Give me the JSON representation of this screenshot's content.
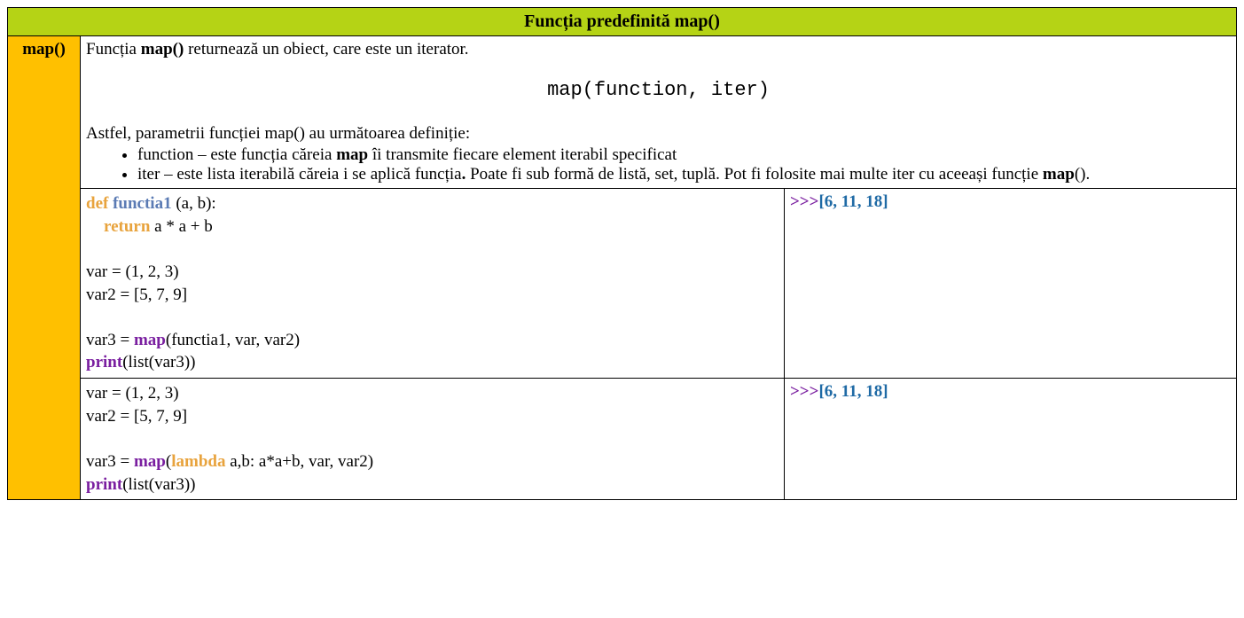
{
  "header": {
    "title": "Funcția predefinită map()"
  },
  "sidebar": {
    "label": "map()"
  },
  "desc": {
    "intro_pre": "Funcția ",
    "intro_bold": "map()",
    "intro_post": " returnează un obiect, care este un iterator.",
    "signature": "map(function, iter)",
    "params_intro": "Astfel, parametrii funcției map() au următoarea definiție:",
    "bullet1_pre": "function – este funcția căreia ",
    "bullet1_bold": "map",
    "bullet1_post": " îi transmite fiecare element iterabil specificat",
    "bullet2_pre": "iter – este lista iterabilă căreia i se aplică funcția",
    "bullet2_dot_bold": ".",
    "bullet2_mid": " Poate fi sub formă de listă, set, tuplă. Pot fi folosite mai multe iter cu aceeași funcție ",
    "bullet2_bold": "map",
    "bullet2_post": "()."
  },
  "code1": {
    "kw_def": "def",
    "fn_name": "functia1",
    "def_rest": " (a, b):",
    "kw_return": "return",
    "ret_rest": " a * a + b",
    "l_var": "var = (1, 2, 3)",
    "l_var2": "var2 = [5, 7, 9]",
    "l_assign_pre": "var3 = ",
    "kw_map": "map",
    "l_assign_post": "(functia1, var, var2)",
    "kw_print": "print",
    "l_print_post": "(list(var3))",
    "out_arrow": ">>>",
    "out_value": "[6, 11, 18]"
  },
  "code2": {
    "l_var": "var = (1, 2, 3)",
    "l_var2": "var2 = [5, 7, 9]",
    "l_assign_pre": "var3 = ",
    "kw_map": "map",
    "paren_open": "(",
    "kw_lambda": "lambda",
    "lambda_rest": " a,b: a*a+b, var, var2)",
    "kw_print": "print",
    "l_print_post": "(list(var3))",
    "out_arrow": ">>>",
    "out_value": "[6, 11, 18]"
  }
}
